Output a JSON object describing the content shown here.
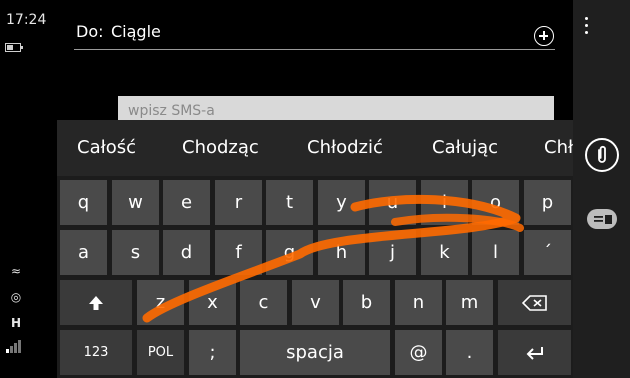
{
  "status": {
    "time": "17:24",
    "network_type": "H",
    "battery_level": 0.45
  },
  "recipient": {
    "label": "Do:",
    "value": "Ciągle"
  },
  "message": {
    "placeholder": "wpisz SMS-a"
  },
  "suggestions": [
    "Całość",
    "Chodząc",
    "Chłodzić",
    "Całując",
    "Chł"
  ],
  "keyboard": {
    "row1": [
      "q",
      "w",
      "e",
      "r",
      "t",
      "y",
      "u",
      "i",
      "o",
      "p"
    ],
    "row2": [
      "a",
      "s",
      "d",
      "f",
      "g",
      "h",
      "j",
      "k",
      "l",
      "´"
    ],
    "row3": [
      "z",
      "x",
      "c",
      "v",
      "b",
      "n",
      "m"
    ],
    "row4": {
      "numbers": "123",
      "language": "POL",
      "semicolon": ";",
      "space": "spacja",
      "at": "@",
      "period": "."
    }
  },
  "colors": {
    "swipe_trail": "#ff6a00",
    "key": "#4a4a4a",
    "background": "#000000"
  },
  "icons": [
    "more-icon",
    "add-recipient-icon",
    "attach-icon",
    "quick-reply-icon",
    "shift-icon",
    "backspace-icon",
    "enter-icon"
  ]
}
